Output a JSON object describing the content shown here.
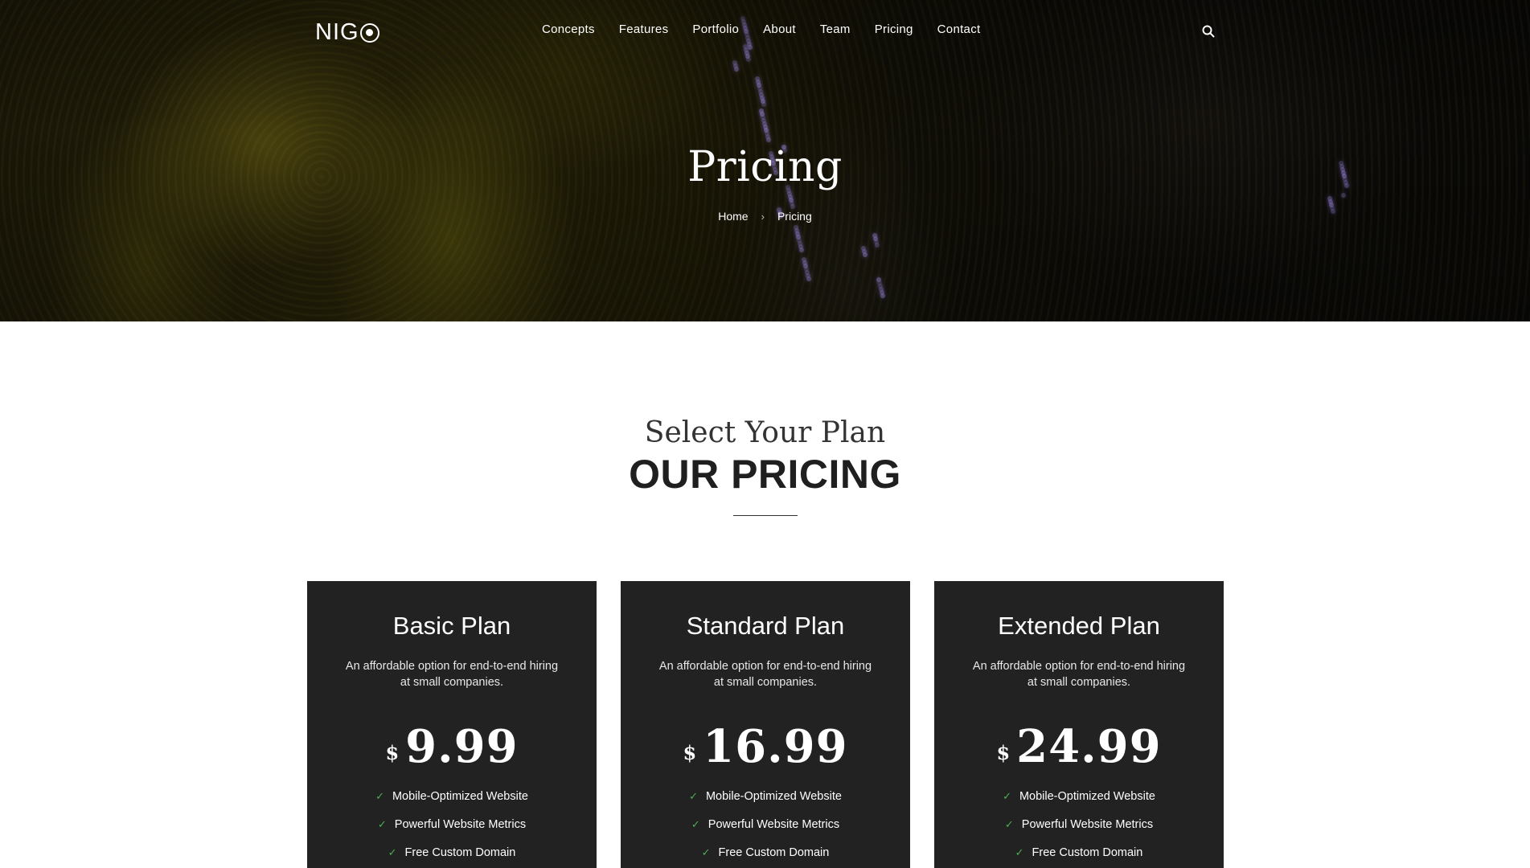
{
  "brand": {
    "logo_text": "NIG"
  },
  "nav": {
    "items": [
      "Concepts",
      "Features",
      "Portfolio",
      "About",
      "Team",
      "Pricing",
      "Contact"
    ]
  },
  "hero": {
    "title": "Pricing",
    "breadcrumb": {
      "home": "Home",
      "separator": "›",
      "current": "Pricing"
    }
  },
  "section": {
    "subtitle": "Select Your Plan",
    "heading": "OUR PRICING"
  },
  "plans": [
    {
      "name": "Basic Plan",
      "description": "An affordable option for end-to-end hiring at small companies.",
      "currency": "$",
      "price": "9.99",
      "features": [
        "Mobile-Optimized Website",
        "Powerful Website Metrics",
        "Free Custom Domain"
      ]
    },
    {
      "name": "Standard Plan",
      "description": "An affordable option for end-to-end hiring at small companies.",
      "currency": "$",
      "price": "16.99",
      "features": [
        "Mobile-Optimized Website",
        "Powerful Website Metrics",
        "Free Custom Domain"
      ]
    },
    {
      "name": "Extended Plan",
      "description": "An affordable option for end-to-end hiring at small companies.",
      "currency": "$",
      "price": "24.99",
      "features": [
        "Mobile-Optimized Website",
        "Powerful Website Metrics",
        "Free Custom Domain"
      ]
    }
  ],
  "icons": {
    "search": "search-icon",
    "check": "check-icon",
    "logo": "logo-circle-icon"
  },
  "colors": {
    "card_bg": "#222223",
    "check": "#4caf50",
    "heading": "#1f1f1f"
  }
}
